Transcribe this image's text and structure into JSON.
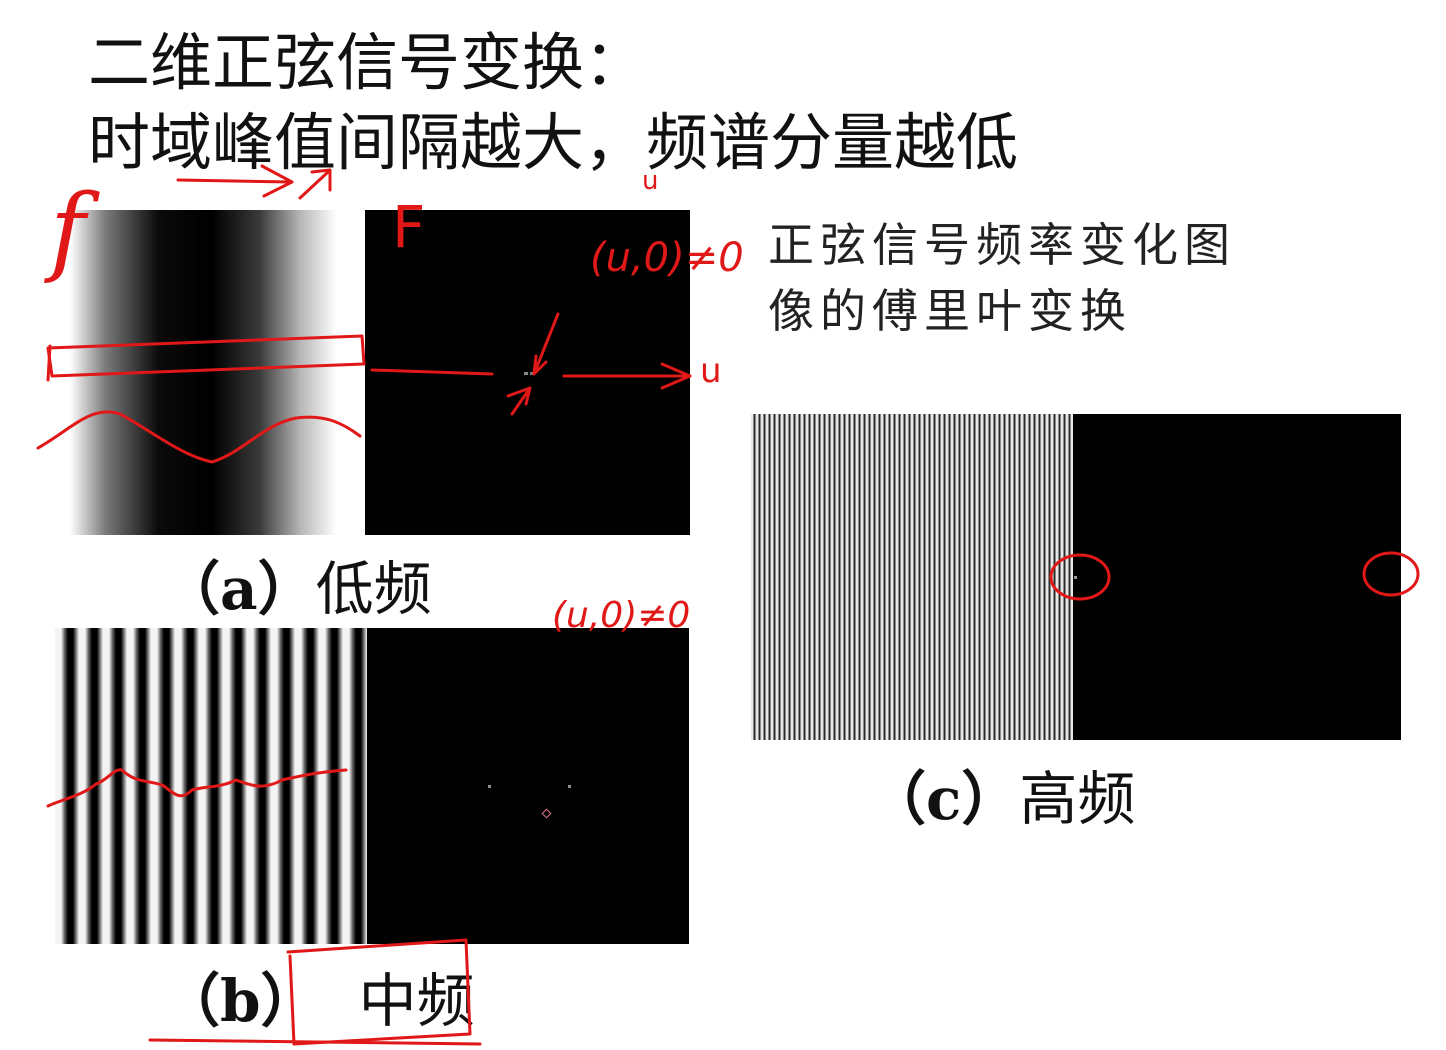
{
  "heading": {
    "line1": "二维正弦信号变换：",
    "line2": "时域峰值间隔越大，频谱分量越低"
  },
  "note": {
    "line1": "正弦信号频率变化图",
    "line2": "像的傅里叶变换"
  },
  "captions": {
    "a": {
      "label": "（a）",
      "text": "低频"
    },
    "b": {
      "label": "（b）",
      "text": "中频"
    },
    "c": {
      "label": "（c）",
      "text": "高频"
    }
  },
  "annotations": {
    "f_lower": "f",
    "F_upper": "F",
    "u_axis": "u",
    "u_top": "u",
    "uv_neq_zero_a": "(u,0)≠0",
    "uv_neq_zero_b": "(u,0)≠0"
  },
  "colors": {
    "ink": "#e01818",
    "spectrum_bg": "#000000"
  }
}
